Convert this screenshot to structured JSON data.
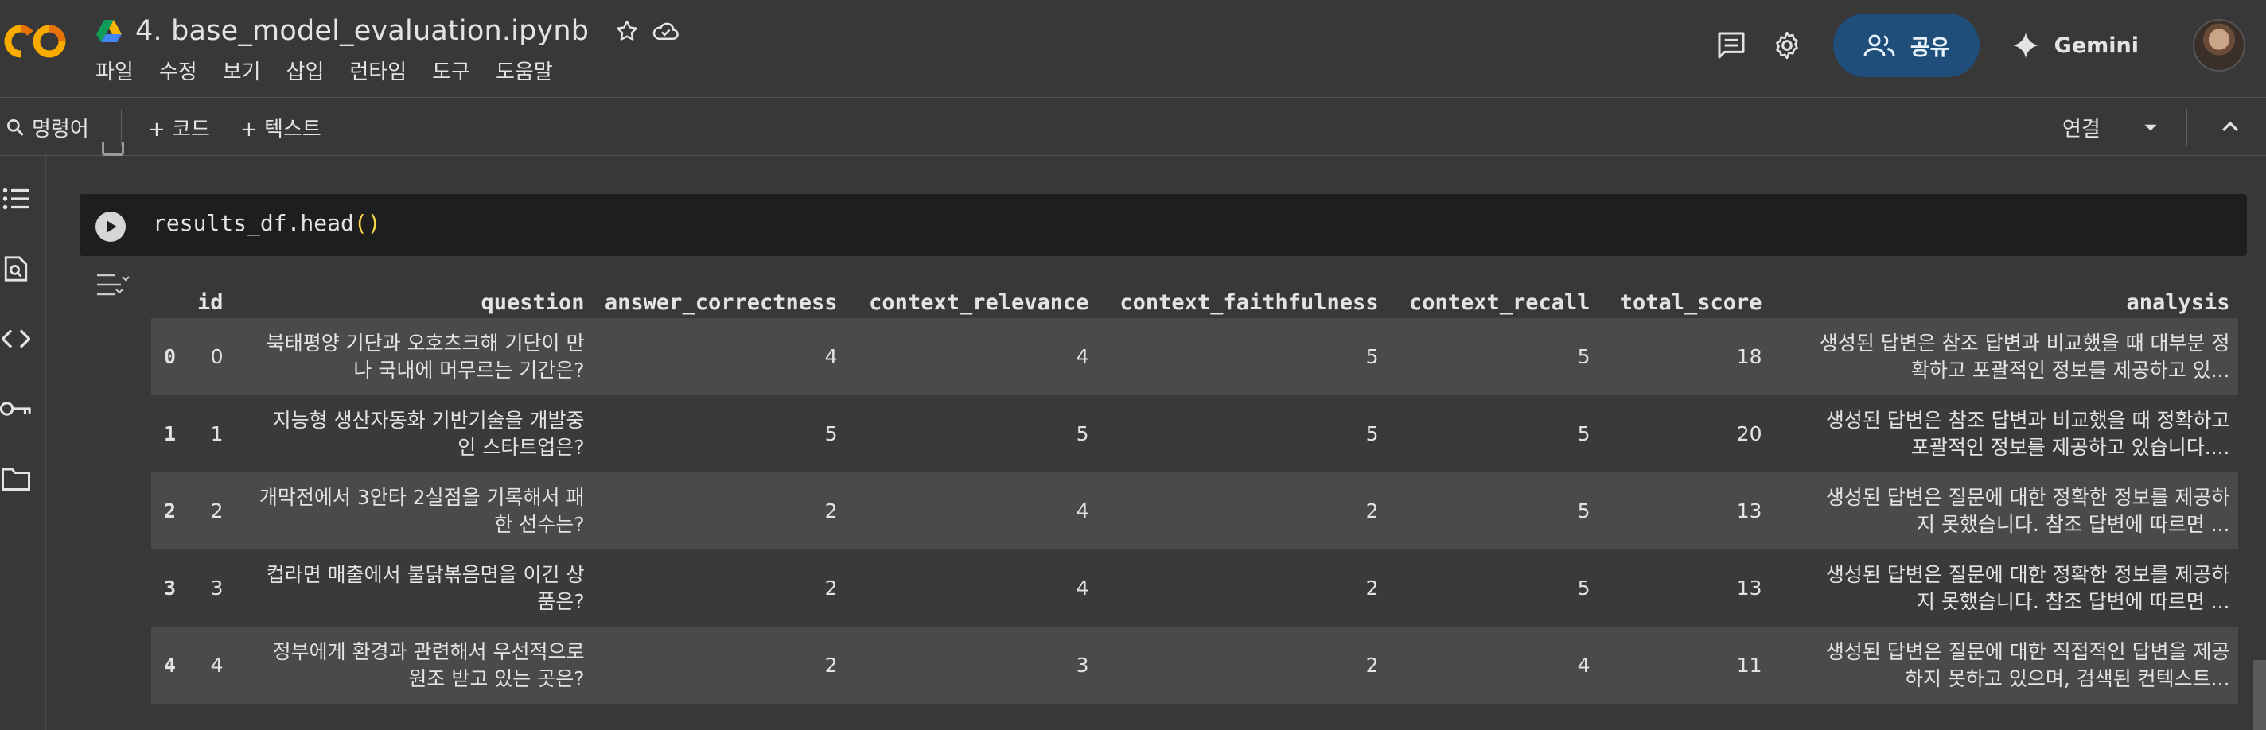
{
  "header": {
    "logo_text": "CO",
    "title": "4. base_model_evaluation.ipynb",
    "icons": [
      "drive-icon",
      "star-icon",
      "cloud-saved-icon"
    ],
    "menu": [
      "파일",
      "수정",
      "보기",
      "삽입",
      "런타임",
      "도구",
      "도움말"
    ],
    "right_icons": [
      "comment-icon",
      "gear-icon"
    ],
    "share_label": "공유",
    "gemini_label": "Gemini"
  },
  "toolbar": {
    "search_label": "명령어",
    "add_code_label": "+ 코드",
    "add_text_label": "+ 텍스트",
    "connect_label": "연결"
  },
  "rail_icons": [
    "table-of-contents-icon",
    "find-replace-icon",
    "code-snippets-icon",
    "secrets-key-icon",
    "folder-icon"
  ],
  "cell": {
    "code_prefix": "results_df.head",
    "code_parens": "()"
  },
  "table": {
    "columns": [
      "",
      "id",
      "question",
      "answer_correctness",
      "context_relevance",
      "context_faithfulness",
      "context_recall",
      "total_score",
      "analysis"
    ],
    "rows": [
      {
        "index": "0",
        "id": "0",
        "question": [
          "북태평양 기단과 오호츠크해 기단이 만",
          "나 국내에 머무르는 기간은?"
        ],
        "answer_correctness": "4",
        "context_relevance": "4",
        "context_faithfulness": "5",
        "context_recall": "5",
        "total_score": "18",
        "analysis": [
          "생성된 답변은 참조 답변과 비교했을 때 대부분 정",
          "확하고 포괄적인 정보를 제공하고 있..."
        ]
      },
      {
        "index": "1",
        "id": "1",
        "question": [
          "지능형 생산자동화 기반기술을 개발중",
          "인 스타트업은?"
        ],
        "answer_correctness": "5",
        "context_relevance": "5",
        "context_faithfulness": "5",
        "context_recall": "5",
        "total_score": "20",
        "analysis": [
          "생성된 답변은 참조 답변과 비교했을 때 정확하고",
          "포괄적인 정보를 제공하고 있습니다...."
        ]
      },
      {
        "index": "2",
        "id": "2",
        "question": [
          "개막전에서 3안타 2실점을 기록해서 패",
          "한 선수는?"
        ],
        "answer_correctness": "2",
        "context_relevance": "4",
        "context_faithfulness": "2",
        "context_recall": "5",
        "total_score": "13",
        "analysis": [
          "생성된 답변은 질문에 대한 정확한 정보를 제공하",
          "지 못했습니다. 참조 답변에 따르면 ..."
        ]
      },
      {
        "index": "3",
        "id": "3",
        "question": [
          "컵라면 매출에서 불닭볶음면을 이긴 상",
          "품은?"
        ],
        "answer_correctness": "2",
        "context_relevance": "4",
        "context_faithfulness": "2",
        "context_recall": "5",
        "total_score": "13",
        "analysis": [
          "생성된 답변은 질문에 대한 정확한 정보를 제공하",
          "지 못했습니다. 참조 답변에 따르면 ..."
        ]
      },
      {
        "index": "4",
        "id": "4",
        "question": [
          "정부에게 환경과 관련해서 우선적으로",
          "원조 받고 있는 곳은?"
        ],
        "answer_correctness": "2",
        "context_relevance": "3",
        "context_faithfulness": "2",
        "context_recall": "4",
        "total_score": "11",
        "analysis": [
          "생성된 답변은 질문에 대한 직접적인 답변을 제공",
          "하지 못하고 있으며, 검색된 컨텍스트..."
        ]
      }
    ]
  }
}
